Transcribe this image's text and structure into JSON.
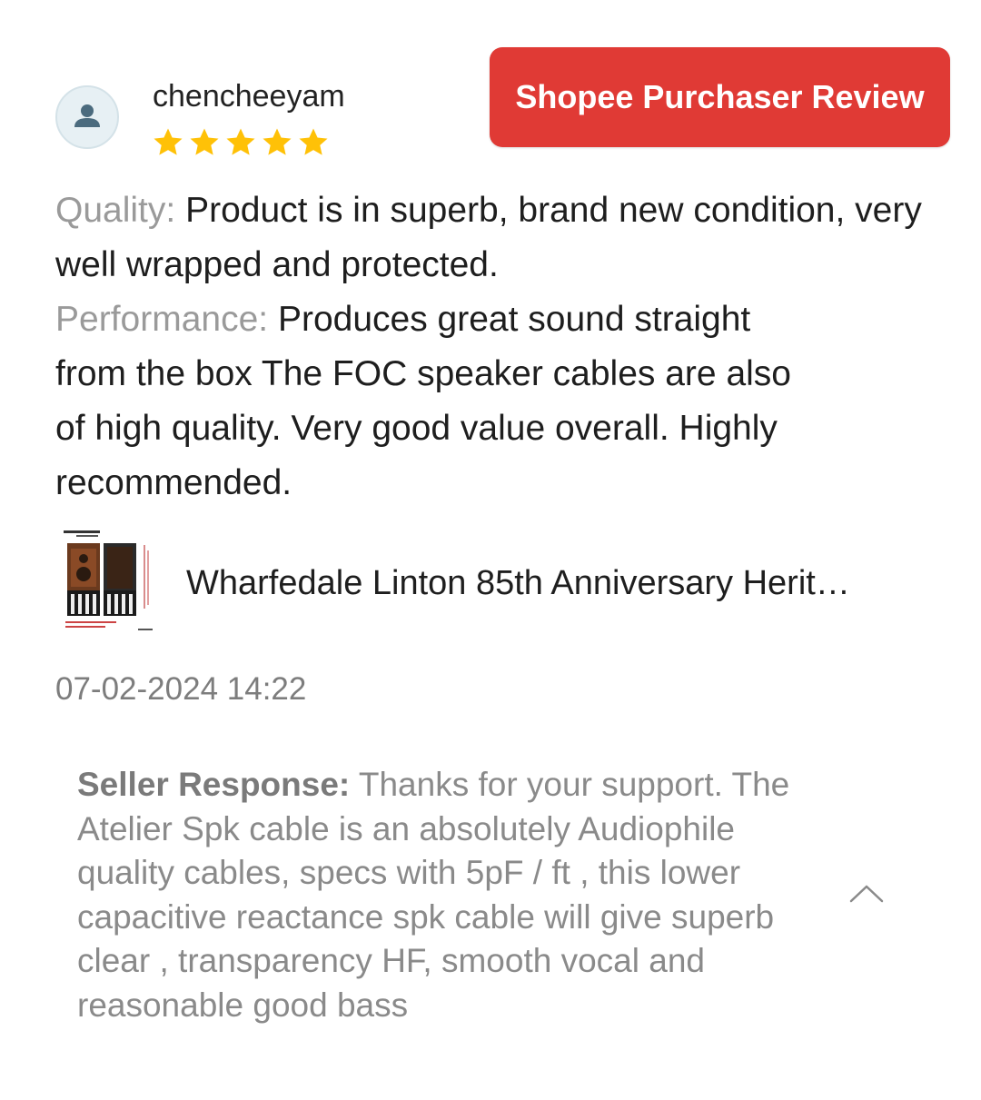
{
  "review": {
    "username": "chencheeyam",
    "rating": 5,
    "rating_max": 5,
    "star_color": "#FFC107",
    "badge_label": "Shopee Purchaser Review",
    "badge_color": "#E03A35",
    "quality_label": "Quality:",
    "quality_text": "Product is in superb, brand new condition, very well wrapped and protected.",
    "performance_label": "Performance:",
    "performance_text": "Produces great sound straight from the box  The FOC speaker cables are also of high quality. Very good value overall. Highly recommended.",
    "product_name": "Wharfedale Linton 85th Anniversary Herit…",
    "date": "07-02-2024 14:22"
  },
  "seller_response": {
    "label": "Seller Response:",
    "text": "Thanks for your support. The Atelier Spk cable is an absolutely Audiophile quality cables, specs with 5pF / ft , this lower capacitive reactance spk cable will give superb clear , transparency HF, smooth vocal and reasonable good bass"
  },
  "icons": {
    "avatar": "user-avatar-icon",
    "star": "star-icon",
    "collapse": "chevron-up-icon"
  }
}
